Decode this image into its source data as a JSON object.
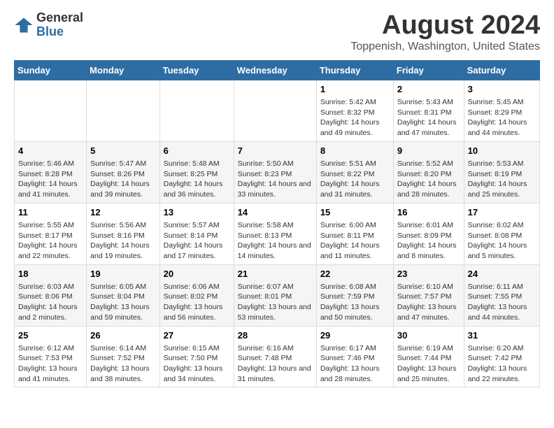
{
  "logo": {
    "general": "General",
    "blue": "Blue"
  },
  "title": "August 2024",
  "subtitle": "Toppenish, Washington, United States",
  "headers": [
    "Sunday",
    "Monday",
    "Tuesday",
    "Wednesday",
    "Thursday",
    "Friday",
    "Saturday"
  ],
  "weeks": [
    [
      {
        "day": "",
        "sunrise": "",
        "sunset": "",
        "daylight": ""
      },
      {
        "day": "",
        "sunrise": "",
        "sunset": "",
        "daylight": ""
      },
      {
        "day": "",
        "sunrise": "",
        "sunset": "",
        "daylight": ""
      },
      {
        "day": "",
        "sunrise": "",
        "sunset": "",
        "daylight": ""
      },
      {
        "day": "1",
        "sunrise": "Sunrise: 5:42 AM",
        "sunset": "Sunset: 8:32 PM",
        "daylight": "Daylight: 14 hours and 49 minutes."
      },
      {
        "day": "2",
        "sunrise": "Sunrise: 5:43 AM",
        "sunset": "Sunset: 8:31 PM",
        "daylight": "Daylight: 14 hours and 47 minutes."
      },
      {
        "day": "3",
        "sunrise": "Sunrise: 5:45 AM",
        "sunset": "Sunset: 8:29 PM",
        "daylight": "Daylight: 14 hours and 44 minutes."
      }
    ],
    [
      {
        "day": "4",
        "sunrise": "Sunrise: 5:46 AM",
        "sunset": "Sunset: 8:28 PM",
        "daylight": "Daylight: 14 hours and 41 minutes."
      },
      {
        "day": "5",
        "sunrise": "Sunrise: 5:47 AM",
        "sunset": "Sunset: 8:26 PM",
        "daylight": "Daylight: 14 hours and 39 minutes."
      },
      {
        "day": "6",
        "sunrise": "Sunrise: 5:48 AM",
        "sunset": "Sunset: 8:25 PM",
        "daylight": "Daylight: 14 hours and 36 minutes."
      },
      {
        "day": "7",
        "sunrise": "Sunrise: 5:50 AM",
        "sunset": "Sunset: 8:23 PM",
        "daylight": "Daylight: 14 hours and 33 minutes."
      },
      {
        "day": "8",
        "sunrise": "Sunrise: 5:51 AM",
        "sunset": "Sunset: 8:22 PM",
        "daylight": "Daylight: 14 hours and 31 minutes."
      },
      {
        "day": "9",
        "sunrise": "Sunrise: 5:52 AM",
        "sunset": "Sunset: 8:20 PM",
        "daylight": "Daylight: 14 hours and 28 minutes."
      },
      {
        "day": "10",
        "sunrise": "Sunrise: 5:53 AM",
        "sunset": "Sunset: 8:19 PM",
        "daylight": "Daylight: 14 hours and 25 minutes."
      }
    ],
    [
      {
        "day": "11",
        "sunrise": "Sunrise: 5:55 AM",
        "sunset": "Sunset: 8:17 PM",
        "daylight": "Daylight: 14 hours and 22 minutes."
      },
      {
        "day": "12",
        "sunrise": "Sunrise: 5:56 AM",
        "sunset": "Sunset: 8:16 PM",
        "daylight": "Daylight: 14 hours and 19 minutes."
      },
      {
        "day": "13",
        "sunrise": "Sunrise: 5:57 AM",
        "sunset": "Sunset: 8:14 PM",
        "daylight": "Daylight: 14 hours and 17 minutes."
      },
      {
        "day": "14",
        "sunrise": "Sunrise: 5:58 AM",
        "sunset": "Sunset: 8:13 PM",
        "daylight": "Daylight: 14 hours and 14 minutes."
      },
      {
        "day": "15",
        "sunrise": "Sunrise: 6:00 AM",
        "sunset": "Sunset: 8:11 PM",
        "daylight": "Daylight: 14 hours and 11 minutes."
      },
      {
        "day": "16",
        "sunrise": "Sunrise: 6:01 AM",
        "sunset": "Sunset: 8:09 PM",
        "daylight": "Daylight: 14 hours and 8 minutes."
      },
      {
        "day": "17",
        "sunrise": "Sunrise: 6:02 AM",
        "sunset": "Sunset: 8:08 PM",
        "daylight": "Daylight: 14 hours and 5 minutes."
      }
    ],
    [
      {
        "day": "18",
        "sunrise": "Sunrise: 6:03 AM",
        "sunset": "Sunset: 8:06 PM",
        "daylight": "Daylight: 14 hours and 2 minutes."
      },
      {
        "day": "19",
        "sunrise": "Sunrise: 6:05 AM",
        "sunset": "Sunset: 8:04 PM",
        "daylight": "Daylight: 13 hours and 59 minutes."
      },
      {
        "day": "20",
        "sunrise": "Sunrise: 6:06 AM",
        "sunset": "Sunset: 8:02 PM",
        "daylight": "Daylight: 13 hours and 56 minutes."
      },
      {
        "day": "21",
        "sunrise": "Sunrise: 6:07 AM",
        "sunset": "Sunset: 8:01 PM",
        "daylight": "Daylight: 13 hours and 53 minutes."
      },
      {
        "day": "22",
        "sunrise": "Sunrise: 6:08 AM",
        "sunset": "Sunset: 7:59 PM",
        "daylight": "Daylight: 13 hours and 50 minutes."
      },
      {
        "day": "23",
        "sunrise": "Sunrise: 6:10 AM",
        "sunset": "Sunset: 7:57 PM",
        "daylight": "Daylight: 13 hours and 47 minutes."
      },
      {
        "day": "24",
        "sunrise": "Sunrise: 6:11 AM",
        "sunset": "Sunset: 7:55 PM",
        "daylight": "Daylight: 13 hours and 44 minutes."
      }
    ],
    [
      {
        "day": "25",
        "sunrise": "Sunrise: 6:12 AM",
        "sunset": "Sunset: 7:53 PM",
        "daylight": "Daylight: 13 hours and 41 minutes."
      },
      {
        "day": "26",
        "sunrise": "Sunrise: 6:14 AM",
        "sunset": "Sunset: 7:52 PM",
        "daylight": "Daylight: 13 hours and 38 minutes."
      },
      {
        "day": "27",
        "sunrise": "Sunrise: 6:15 AM",
        "sunset": "Sunset: 7:50 PM",
        "daylight": "Daylight: 13 hours and 34 minutes."
      },
      {
        "day": "28",
        "sunrise": "Sunrise: 6:16 AM",
        "sunset": "Sunset: 7:48 PM",
        "daylight": "Daylight: 13 hours and 31 minutes."
      },
      {
        "day": "29",
        "sunrise": "Sunrise: 6:17 AM",
        "sunset": "Sunset: 7:46 PM",
        "daylight": "Daylight: 13 hours and 28 minutes."
      },
      {
        "day": "30",
        "sunrise": "Sunrise: 6:19 AM",
        "sunset": "Sunset: 7:44 PM",
        "daylight": "Daylight: 13 hours and 25 minutes."
      },
      {
        "day": "31",
        "sunrise": "Sunrise: 6:20 AM",
        "sunset": "Sunset: 7:42 PM",
        "daylight": "Daylight: 13 hours and 22 minutes."
      }
    ]
  ]
}
